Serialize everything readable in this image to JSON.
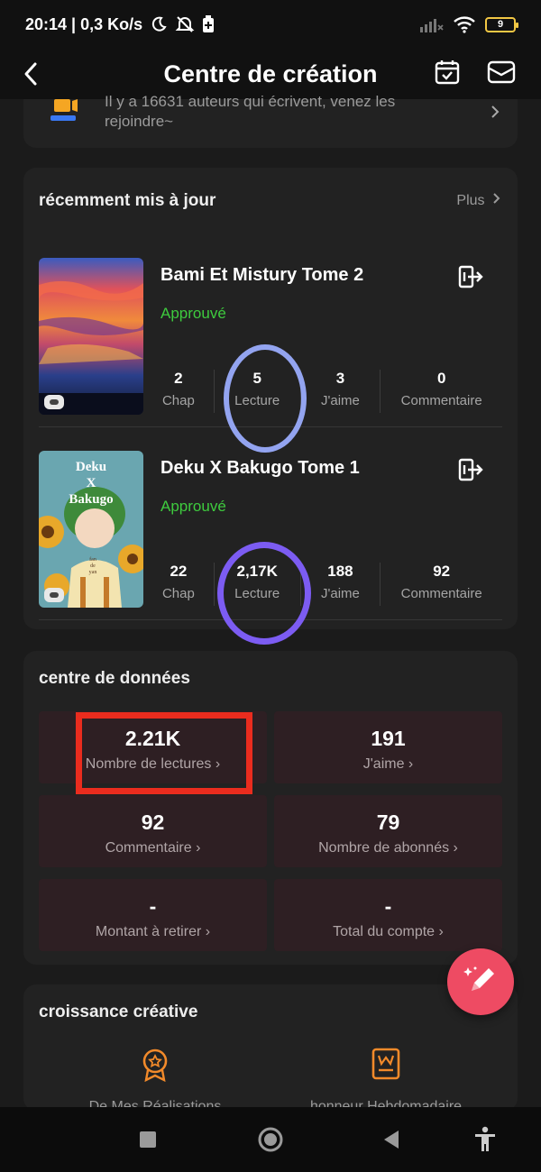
{
  "status_bar": {
    "left_text": "20:14 | 0,3 Ko/s",
    "battery": "9"
  },
  "header": {
    "title": "Centre de création"
  },
  "banner": {
    "text": "Il y a 16631 auteurs qui écrivent, venez les rejoindre~"
  },
  "recent": {
    "title": "récemment mis à jour",
    "more_label": "Plus",
    "books": [
      {
        "title": "Bami Et Mistury Tome 2",
        "status": "Approuvé",
        "stats": [
          {
            "value": "2",
            "label": "Chap"
          },
          {
            "value": "5",
            "label": "Lecture"
          },
          {
            "value": "3",
            "label": "J'aime"
          },
          {
            "value": "0",
            "label": "Commentaire"
          }
        ]
      },
      {
        "title": "Deku X Bakugo Tome 1",
        "status": "Approuvé",
        "cover_title": [
          "Deku",
          "X",
          "Bakugo"
        ],
        "cover_sub": [
          "fan",
          "de",
          "yan"
        ],
        "stats": [
          {
            "value": "22",
            "label": "Chap"
          },
          {
            "value": "2,17K",
            "label": "Lecture"
          },
          {
            "value": "188",
            "label": "J'aime"
          },
          {
            "value": "92",
            "label": "Commentaire"
          }
        ]
      }
    ]
  },
  "data_center": {
    "title": "centre de données",
    "tiles": [
      {
        "value": "2.21K",
        "label": "Nombre de lectures"
      },
      {
        "value": "191",
        "label": "J'aime"
      },
      {
        "value": "92",
        "label": "Commentaire"
      },
      {
        "value": "79",
        "label": "Nombre de abonnés"
      },
      {
        "value": "-",
        "label": "Montant à retirer"
      },
      {
        "value": "-",
        "label": "Total du compte"
      }
    ]
  },
  "growth": {
    "title": "croissance créative",
    "items": [
      {
        "label": "De Mes Réalisations",
        "icon": "award-badge-icon"
      },
      {
        "label": "honneur Hebdomadaire",
        "icon": "honor-certificate-icon"
      }
    ]
  },
  "colors": {
    "accent_green": "#3ecb3e",
    "tile_bg": "#2e1f23",
    "fab": "#ee4b63",
    "highlight_red": "#ea2c1e",
    "ring_light": "#93a4f0",
    "ring_dark": "#7c5cf2",
    "growth_icon": "#f28a2a"
  }
}
